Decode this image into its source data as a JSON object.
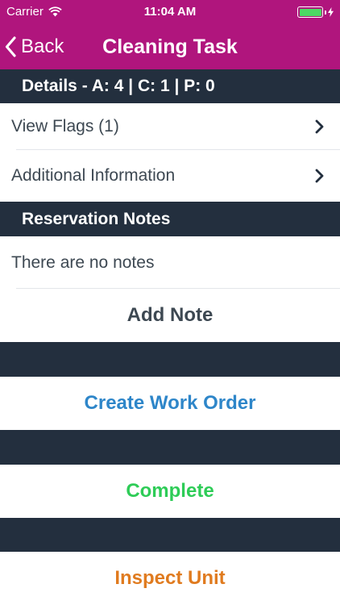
{
  "status_bar": {
    "carrier": "Carrier",
    "time": "11:04 AM"
  },
  "nav": {
    "back_label": "Back",
    "title": "Cleaning Task"
  },
  "details": {
    "header": "Details - A: 4 | C: 1 | P: 0",
    "items": [
      {
        "label": "View Flags  (1)"
      },
      {
        "label": "Additional Information"
      }
    ]
  },
  "notes": {
    "header": "Reservation Notes",
    "empty_text": "There are no notes",
    "add_label": "Add Note"
  },
  "actions": {
    "create_work_order": "Create Work Order",
    "complete": "Complete",
    "inspect_unit": "Inspect Unit"
  },
  "colors": {
    "brand": "#b0157d",
    "dark": "#232f3e",
    "work_order": "#2e86c9",
    "complete": "#2ecc57",
    "inspect": "#e07b1f",
    "text": "#3d4852"
  }
}
